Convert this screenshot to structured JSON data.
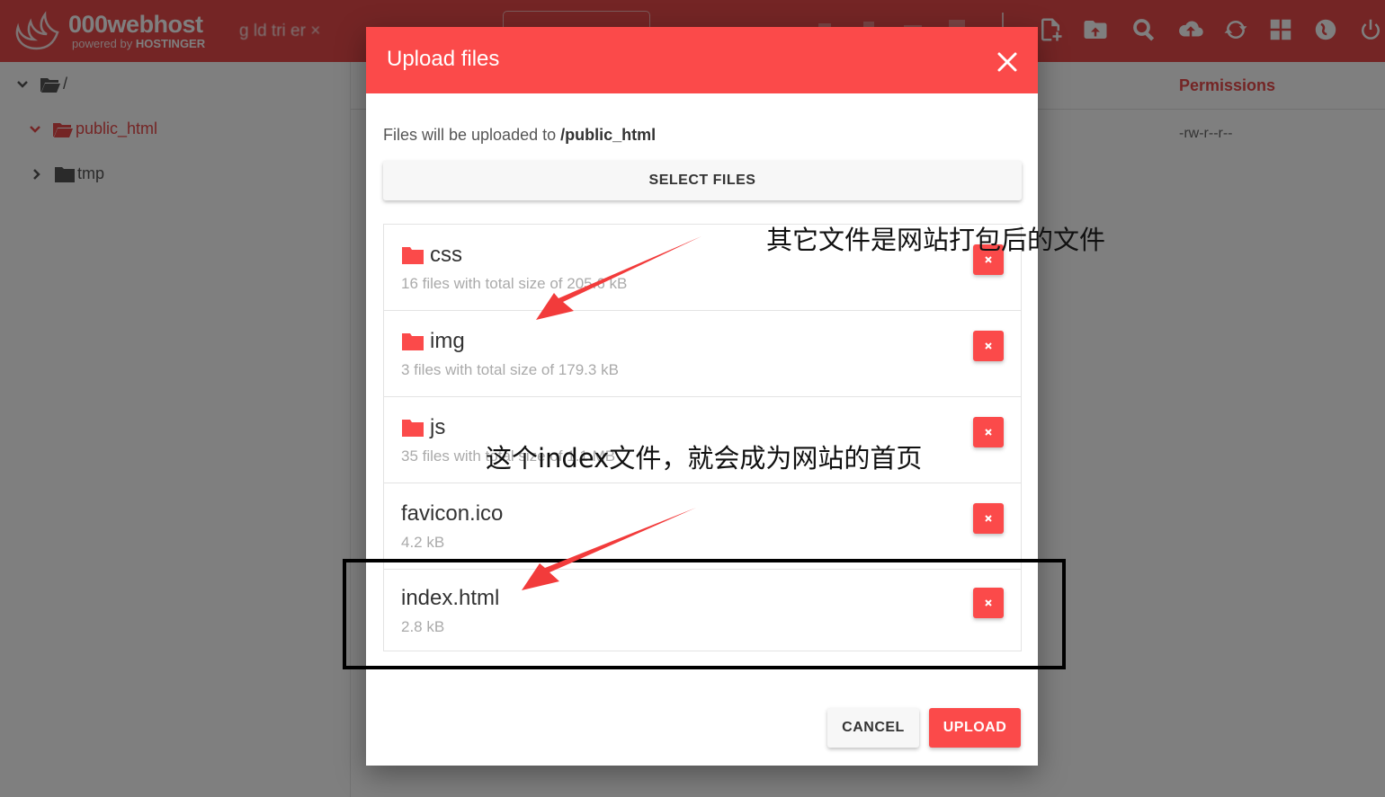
{
  "app": {
    "brand": "000webhost",
    "brand_sub_prefix": "powered by ",
    "brand_sub_strong": "HOSTINGER",
    "breadcrumb_fragment": "g  ld  tri  er",
    "icons": [
      "upload-file-icon",
      "folder-upload-icon",
      "search-icon",
      "cloud-upload-icon",
      "refresh-icon",
      "grid-view-icon",
      "globe-icon",
      "power-icon"
    ]
  },
  "tree": {
    "root_label": "/",
    "items": [
      {
        "label": "public_html",
        "active": true
      },
      {
        "label": "tmp",
        "active": false
      }
    ]
  },
  "table": {
    "permissions_header": "Permissions",
    "permissions_value": "-rw-r--r--"
  },
  "modal": {
    "title": "Upload files",
    "dest_prefix": "Files will be uploaded to ",
    "dest_path": "/public_html",
    "select_label": "SELECT FILES",
    "files": [
      {
        "name": "css",
        "meta": "16 files with total size of 205.6 kB",
        "folder": true
      },
      {
        "name": "img",
        "meta": "3 files with total size of 179.3 kB",
        "folder": true
      },
      {
        "name": "js",
        "meta": "35 files with total size of 1.1 MB",
        "folder": true
      },
      {
        "name": "favicon.ico",
        "meta": "4.2 kB",
        "folder": false
      },
      {
        "name": "index.html",
        "meta": "2.8 kB",
        "folder": false
      }
    ],
    "cancel_label": "CANCEL",
    "upload_label": "UPLOAD"
  },
  "annotations": {
    "note_other_files": "其它文件是网站打包后的文件",
    "note_index": "这个index文件，就会成为网站的首页"
  },
  "colors": {
    "brand_red": "#e84a4a",
    "button_red": "#fb4a4a"
  }
}
